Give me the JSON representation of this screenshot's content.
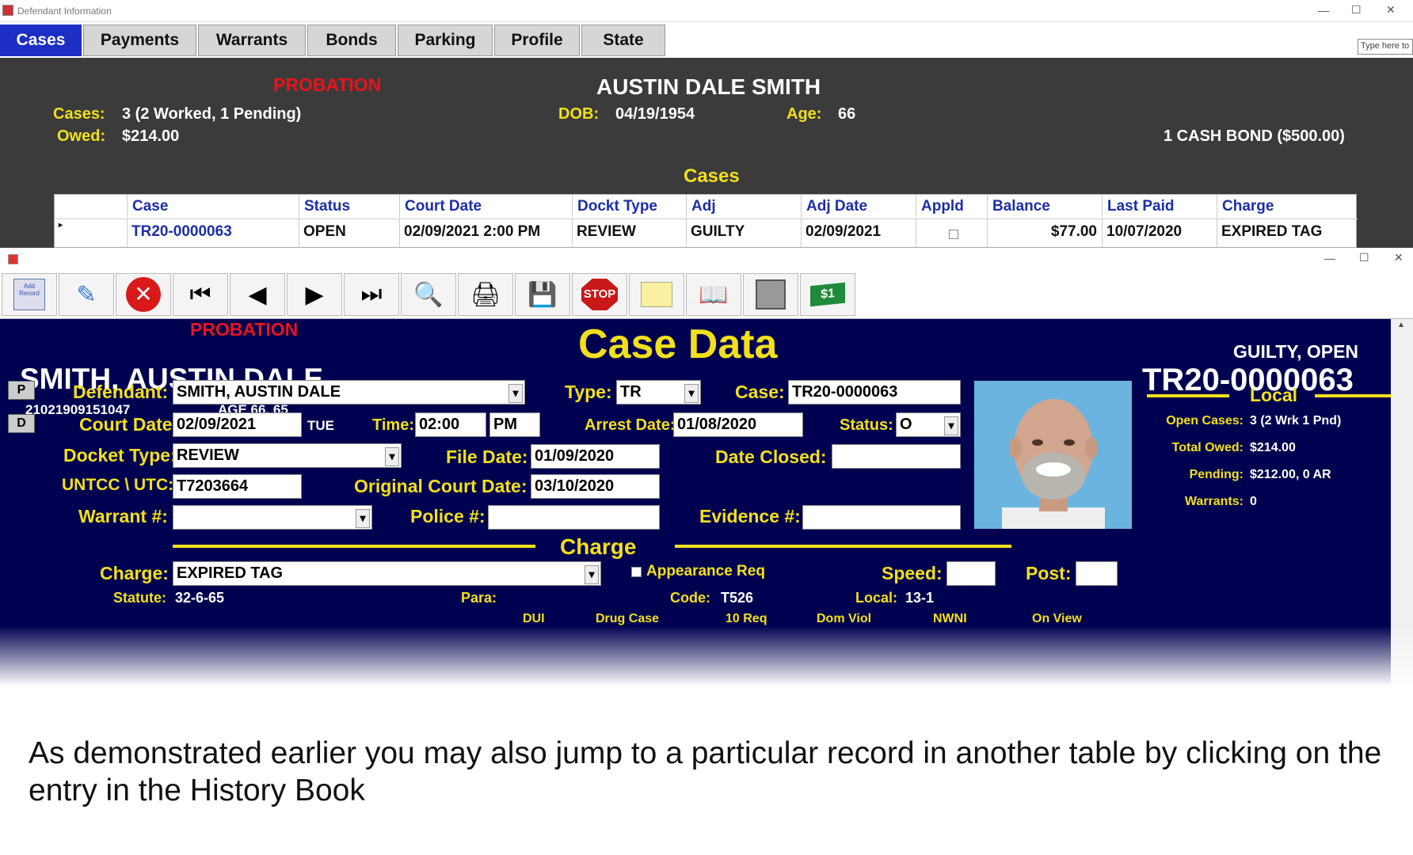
{
  "window1": {
    "title": "Defendant Information",
    "type_here": "Type here to"
  },
  "tabs": [
    "Cases",
    "Payments",
    "Warrants",
    "Bonds",
    "Parking",
    "Profile",
    "State"
  ],
  "header": {
    "probation": "PROBATION",
    "name": "AUSTIN DALE SMITH",
    "cases_label": "Cases:",
    "cases_value": "3 (2 Worked, 1 Pending)",
    "owed_label": "Owed:",
    "owed_value": "$214.00",
    "dob_label": "DOB:",
    "dob_value": "04/19/1954",
    "age_label": "Age:",
    "age_value": "66",
    "bond": "1 CASH BOND ($500.00)",
    "section": "Cases"
  },
  "cases_table": {
    "columns": [
      "Case",
      "Status",
      "Court Date",
      "Dockt Type",
      "Adj",
      "Adj Date",
      "Appld",
      "Balance",
      "Last Paid",
      "Charge"
    ],
    "row": [
      "TR20-0000063",
      "OPEN",
      "02/09/2021 2:00 PM",
      "REVIEW",
      "GUILTY",
      "02/09/2021",
      "",
      "$77.00",
      "10/07/2020",
      "EXPIRED TAG"
    ]
  },
  "toolbar": {
    "add_record": "Add Record",
    "edit": "Edit",
    "stop": "STOP",
    "dollar": "$1"
  },
  "case_data": {
    "probation": "PROBATION",
    "title": "Case Data",
    "status_line": "GUILTY,  OPEN",
    "case_number": "TR20-0000063",
    "name": "SMITH, AUSTIN DALE",
    "id": "21021909151047",
    "age": "AGE  66, 65",
    "p_btn": "P",
    "d_btn": "D",
    "defendant_label": "Defendant:",
    "defendant_value": "SMITH, AUSTIN DALE",
    "type_label": "Type:",
    "type_value": "TR",
    "case_label": "Case:",
    "case_value": "TR20-0000063",
    "court_date_label": "Court Date:",
    "court_date_value": "02/09/2021",
    "court_day": "TUE",
    "time_label": "Time:",
    "time_value": "02:00",
    "ampm": "PM",
    "arrest_label": "Arrest Date:",
    "arrest_value": "01/08/2020",
    "status_label": "Status:",
    "status_value": "O",
    "docket_label": "Docket Type:",
    "docket_value": "REVIEW",
    "file_date_label": "File Date:",
    "file_date_value": "01/09/2020",
    "date_closed_label": "Date Closed:",
    "date_closed_value": "",
    "untcc_label": "UNTCC \\ UTC:",
    "untcc_value": "T7203664",
    "orig_court_label": "Original Court Date:",
    "orig_court_value": "03/10/2020",
    "warrant_label": "Warrant #:",
    "warrant_value": "",
    "police_label": "Police #:",
    "police_value": "",
    "evidence_label": "Evidence #:",
    "evidence_value": "",
    "charge_section": "Charge",
    "charge_label": "Charge:",
    "charge_value": "EXPIRED TAG",
    "appearance_label": "Appearance Req",
    "speed_label": "Speed:",
    "speed_value": "",
    "post_label": "Post:",
    "post_value": "",
    "statute_label": "Statute:",
    "statute_value": "32-6-65",
    "para_label": "Para:",
    "code_label": "Code:",
    "code_value": "T526",
    "local_code_label": "Local:",
    "local_code_value": "13-1",
    "checkbox_row": [
      "DUI",
      "Drug Case",
      "10 Req",
      "Dom Viol",
      "NWNI",
      "On View"
    ]
  },
  "local": {
    "title": "Local",
    "open_cases_label": "Open Cases:",
    "open_cases_value": "3 (2 Wrk  1 Pnd)",
    "total_owed_label": "Total Owed:",
    "total_owed_value": "$214.00",
    "pending_label": "Pending:",
    "pending_value": "$212.00,  0 AR",
    "warrants_label": "Warrants:",
    "warrants_value": "0"
  },
  "caption": "As demonstrated earlier you may also jump to a particular record in another table by clicking on the entry in the History Book"
}
